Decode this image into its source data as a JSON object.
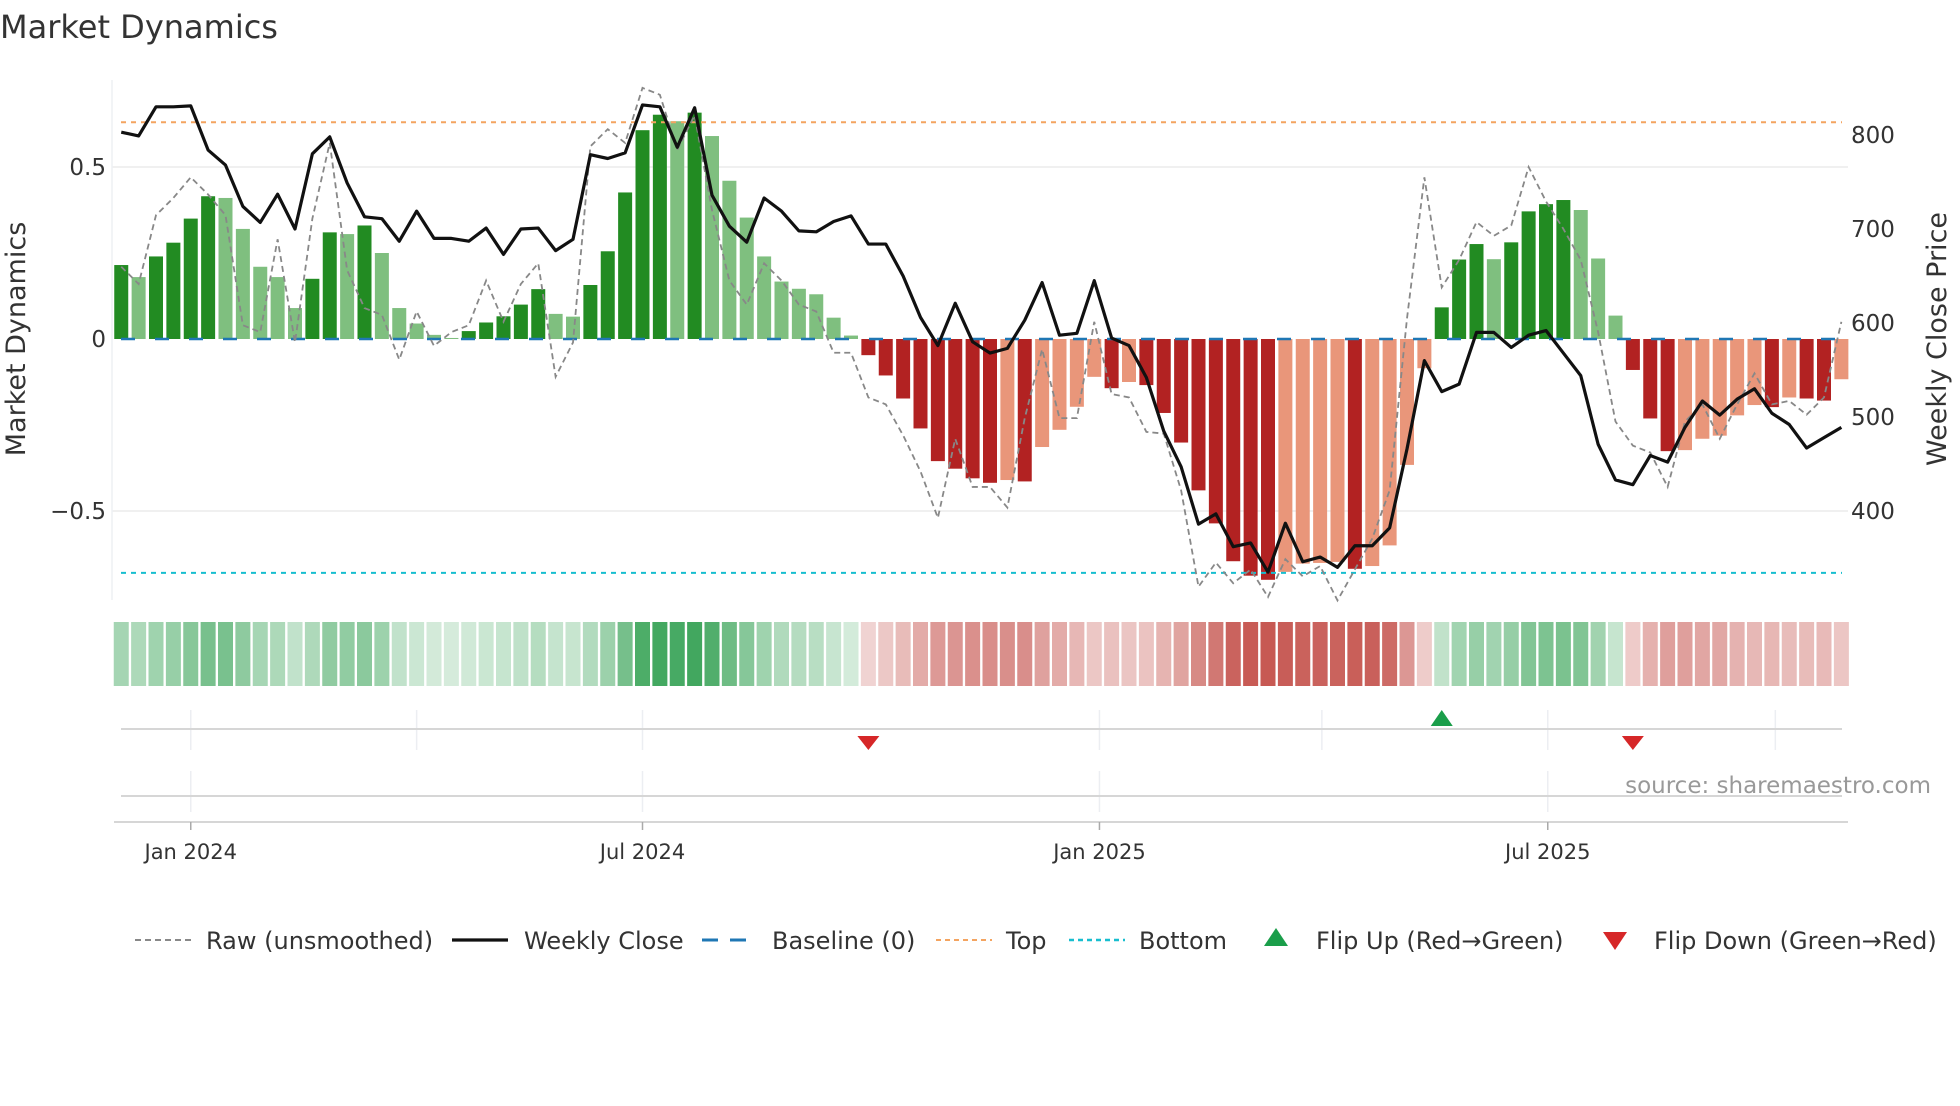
{
  "title": "Market Dynamics",
  "source": "source: sharemaestro.com",
  "chart_data": {
    "type": "bar",
    "title": "Market Dynamics",
    "ylabel": "Market Dynamics",
    "y2label": "Weekly Close Price",
    "x_unit": "week index",
    "ylim": [
      -0.78,
      0.78
    ],
    "y2lim": [
      400,
      800
    ],
    "yticks": [
      {
        "value": 0.5,
        "label": "0.5"
      },
      {
        "value": 0,
        "label": "0"
      },
      {
        "value": -0.5,
        "label": "−0.5"
      }
    ],
    "y2ticks": [
      {
        "value": 800,
        "label": "800"
      },
      {
        "value": 700,
        "label": "700"
      },
      {
        "value": 600,
        "label": "600"
      },
      {
        "value": 500,
        "label": "500"
      },
      {
        "value": 400,
        "label": "400"
      }
    ],
    "xticks": [
      {
        "week": 4,
        "label": "Jan 2024"
      },
      {
        "week": 30,
        "label": "Jul 2024"
      },
      {
        "week": 56.3,
        "label": "Jan 2025"
      },
      {
        "week": 82.1,
        "label": "Jul 2025"
      }
    ],
    "minor_weeks": [
      17,
      69.1,
      95.2
    ],
    "top": 0.63,
    "bottom": -0.68,
    "baseline": 0,
    "bars": [
      0.215,
      0.18,
      0.24,
      0.28,
      0.35,
      0.415,
      0.41,
      0.32,
      0.21,
      0.18,
      0.09,
      0.175,
      0.31,
      0.305,
      0.33,
      0.25,
      0.09,
      0.045,
      0.012,
      0.003,
      0.023,
      0.048,
      0.066,
      0.1,
      0.145,
      0.073,
      0.065,
      0.157,
      0.255,
      0.426,
      0.607,
      0.652,
      0.633,
      0.658,
      0.59,
      0.46,
      0.353,
      0.24,
      0.167,
      0.146,
      0.13,
      0.062,
      0.01,
      -0.047,
      -0.106,
      -0.173,
      -0.26,
      -0.355,
      -0.377,
      -0.405,
      -0.418,
      -0.41,
      -0.414,
      -0.314,
      -0.264,
      -0.197,
      -0.11,
      -0.143,
      -0.125,
      -0.134,
      -0.215,
      -0.301,
      -0.44,
      -0.536,
      -0.646,
      -0.688,
      -0.7,
      -0.677,
      -0.653,
      -0.651,
      -0.648,
      -0.668,
      -0.66,
      -0.6,
      -0.366,
      -0.085,
      0.092,
      0.231,
      0.276,
      0.232,
      0.281,
      0.371,
      0.392,
      0.404,
      0.375,
      0.234,
      0.068,
      -0.09,
      -0.231,
      -0.326,
      -0.323,
      -0.29,
      -0.281,
      -0.222,
      -0.192,
      -0.198,
      -0.17,
      -0.173,
      -0.179,
      -0.117
    ],
    "bar_shade": "DLDDDDLLLLLDDLDLLLLLDDDDDLLDDDDDLDLLLLLLLLLDDDDDDDDLDLLLLDLDDDDDDDDLLLLDLLLLDDDLDDDDLLLDDDLLLLLDLDDL",
    "raw": [
      0.21,
      0.16,
      0.36,
      0.41,
      0.47,
      0.42,
      0.36,
      0.04,
      0.02,
      0.29,
      -0.01,
      0.35,
      0.57,
      0.2,
      0.09,
      0.07,
      -0.06,
      0.08,
      -0.02,
      0.02,
      0.04,
      0.17,
      0.05,
      0.16,
      0.22,
      -0.11,
      -0.01,
      0.56,
      0.61,
      0.57,
      0.73,
      0.71,
      0.55,
      0.65,
      0.375,
      0.17,
      0.1,
      0.22,
      0.17,
      0.1,
      0.08,
      -0.04,
      -0.04,
      -0.17,
      -0.19,
      -0.28,
      -0.385,
      -0.52,
      -0.29,
      -0.43,
      -0.43,
      -0.49,
      -0.23,
      -0.03,
      -0.23,
      -0.23,
      0.05,
      -0.16,
      -0.17,
      -0.27,
      -0.275,
      -0.44,
      -0.72,
      -0.65,
      -0.71,
      -0.67,
      -0.75,
      -0.64,
      -0.69,
      -0.66,
      -0.76,
      -0.67,
      -0.58,
      -0.44,
      0.06,
      0.47,
      0.15,
      0.23,
      0.34,
      0.3,
      0.33,
      0.5,
      0.4,
      0.32,
      0.23,
      0.02,
      -0.24,
      -0.31,
      -0.33,
      -0.43,
      -0.24,
      -0.19,
      -0.29,
      -0.19,
      -0.1,
      -0.19,
      -0.18,
      -0.22,
      -0.17,
      0.05
    ],
    "close": [
      803,
      799,
      830,
      830,
      831,
      784,
      768,
      724,
      707,
      737,
      700,
      780,
      798,
      749,
      713,
      711,
      687,
      719,
      690,
      690,
      687,
      701,
      673,
      700,
      701,
      677,
      689,
      779,
      775,
      781,
      832,
      830,
      787,
      829,
      736,
      703,
      686,
      733,
      719,
      698,
      697,
      708,
      714,
      684,
      684,
      650,
      606,
      576,
      621,
      580,
      568,
      573,
      603,
      643,
      587,
      589,
      645,
      584,
      576,
      542,
      485,
      447,
      386,
      397,
      362,
      366,
      335,
      387,
      346,
      351,
      340,
      363,
      363,
      382,
      466,
      560,
      527,
      535,
      590,
      590,
      574,
      587,
      592,
      568,
      544,
      471,
      433,
      428,
      459,
      452,
      489,
      517,
      502,
      519,
      530,
      504,
      492,
      467,
      478,
      489
    ],
    "flips": [
      {
        "week": 43,
        "type": "down"
      },
      {
        "week": 76,
        "type": "up"
      },
      {
        "week": 87,
        "type": "down"
      }
    ],
    "colors": {
      "green_dark": "#228b22",
      "green_light": "#7fbf7f",
      "red_dark": "#b22222",
      "red_light": "#e9967a",
      "close": "#111111",
      "raw": "#888888",
      "baseline": "#1f77b4",
      "top": "#f4a460",
      "bottom": "#17becf",
      "flip_up": "#1a9e4a",
      "flip_down": "#d62728"
    },
    "legend": [
      {
        "key": "raw",
        "label": "Raw (unsmoothed)"
      },
      {
        "key": "close",
        "label": "Weekly Close"
      },
      {
        "key": "baseline",
        "label": "Baseline (0)"
      },
      {
        "key": "top",
        "label": "Top"
      },
      {
        "key": "bottom",
        "label": "Bottom"
      },
      {
        "key": "flip_up",
        "label": "Flip Up (Red→Green)"
      },
      {
        "key": "flip_down",
        "label": "Flip Down (Green→Red)"
      }
    ],
    "legend_position": "bottom"
  }
}
